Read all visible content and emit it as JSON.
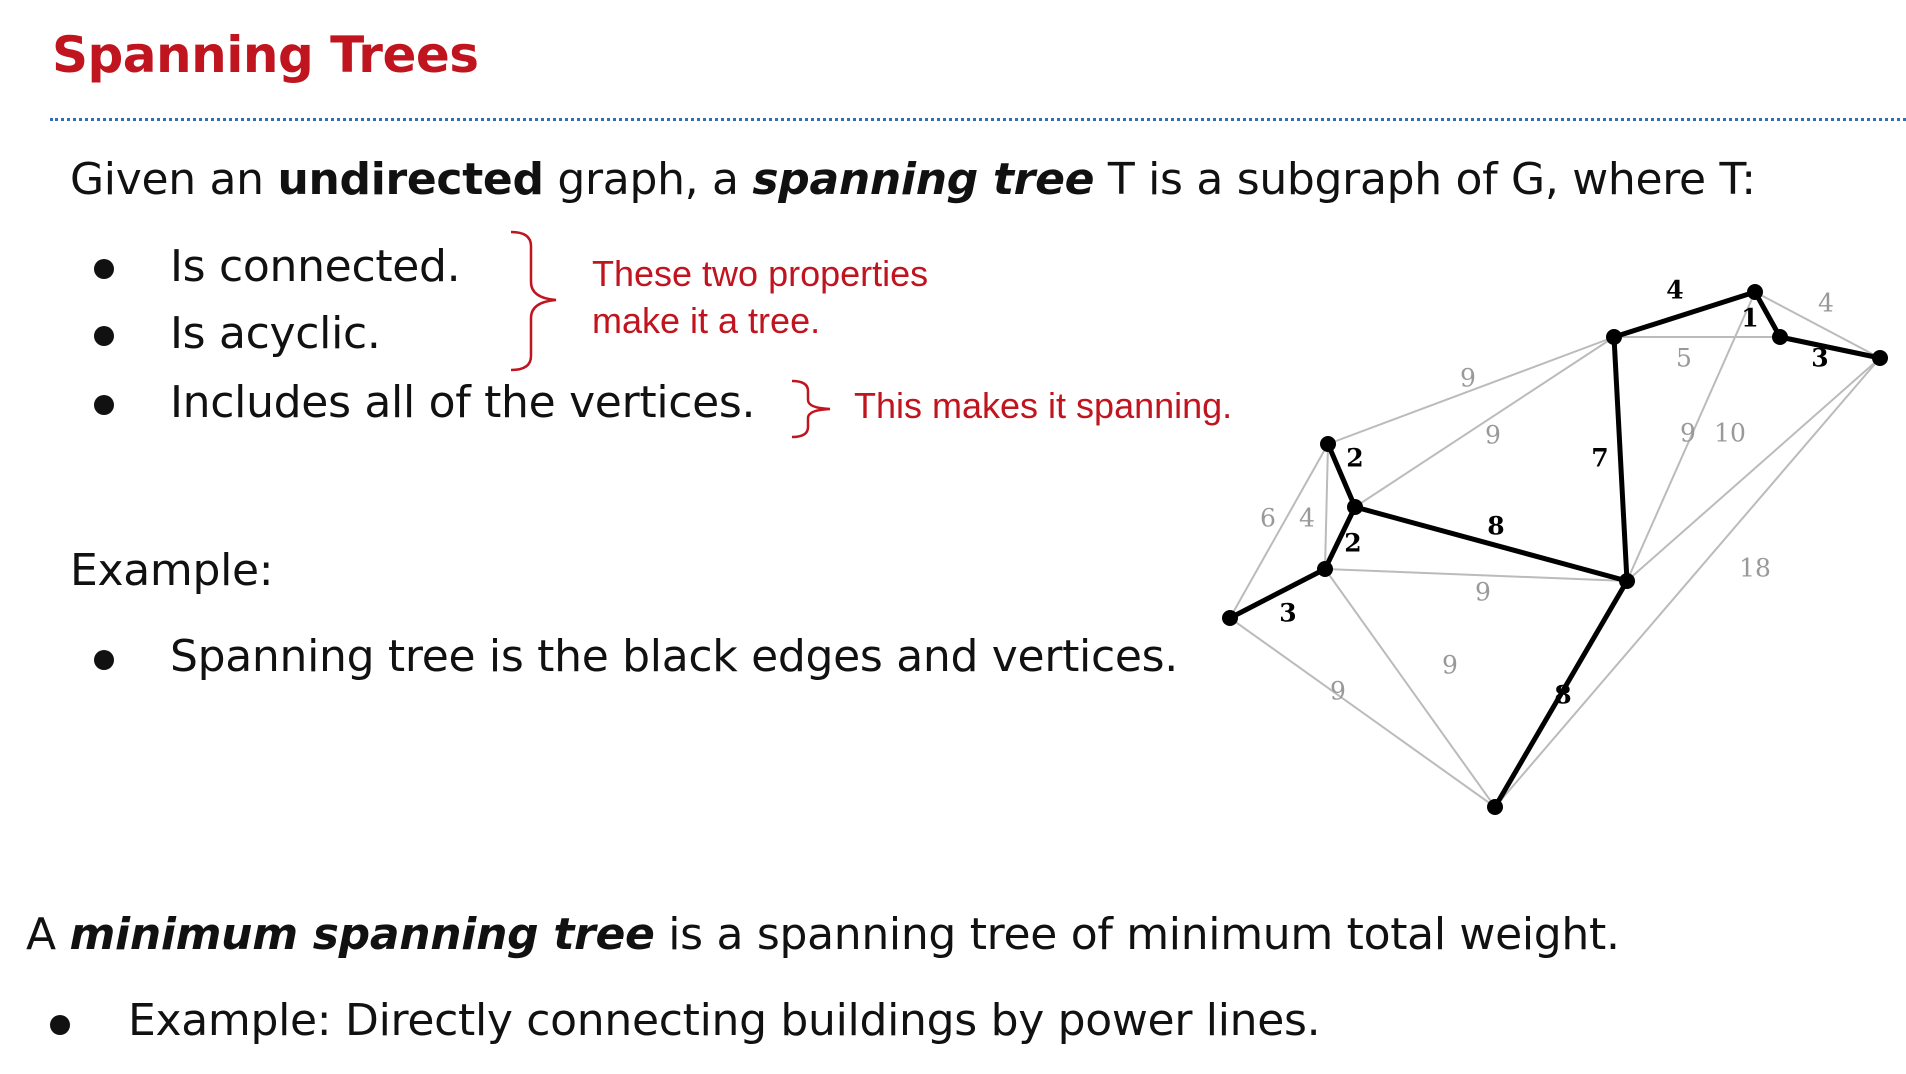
{
  "title": "Spanning Trees",
  "intro": {
    "t1": "Given an ",
    "t2": "undirected",
    "t3": " graph, a ",
    "t4": "spanning tree",
    "t5": " T is a subgraph of G, where T:"
  },
  "properties": [
    "Is connected.",
    "Is acyclic.",
    "Includes all of the vertices."
  ],
  "notes": {
    "tree_line1": "These two properties",
    "tree_line2": "make it a tree.",
    "spanning": "This makes it spanning."
  },
  "example": {
    "heading": "Example:",
    "bullet": "Spanning tree is the black edges and vertices."
  },
  "mst": {
    "t1": "A ",
    "t2": "minimum spanning tree",
    "t3": " is a spanning tree of minimum total weight.",
    "example": "Example: Directly connecting buildings by power lines."
  },
  "colors": {
    "title": "#c0141f",
    "note": "#c0141f",
    "divider": "#2f6fb5",
    "tree_edge": "#000000",
    "other_edge": "#bbbbbb",
    "other_label": "#999999"
  },
  "graph": {
    "vertices": [
      "A",
      "B",
      "C",
      "D",
      "E",
      "F",
      "G",
      "H",
      "I",
      "J"
    ],
    "tree_edges": [
      {
        "from": "A",
        "to": "B",
        "weight": "4"
      },
      {
        "from": "B",
        "to": "C",
        "weight": "1"
      },
      {
        "from": "C",
        "to": "D",
        "weight": "3"
      },
      {
        "from": "A",
        "to": "E",
        "weight": "7"
      },
      {
        "from": "G",
        "to": "E",
        "weight": "8"
      },
      {
        "from": "F",
        "to": "G",
        "weight": "2"
      },
      {
        "from": "G",
        "to": "H",
        "weight": "2"
      },
      {
        "from": "I",
        "to": "H",
        "weight": "3"
      },
      {
        "from": "E",
        "to": "J",
        "weight": "8"
      }
    ],
    "other_edges": [
      {
        "from": "B",
        "to": "D",
        "weight": "4"
      },
      {
        "from": "A",
        "to": "C",
        "weight": "5"
      },
      {
        "from": "F",
        "to": "A",
        "weight": "9"
      },
      {
        "from": "G",
        "to": "A",
        "weight": "9"
      },
      {
        "from": "E",
        "to": "B",
        "weight": "9"
      },
      {
        "from": "E",
        "to": "D",
        "weight": "10"
      },
      {
        "from": "J",
        "to": "D",
        "weight": "18"
      },
      {
        "from": "I",
        "to": "F",
        "weight": "6"
      },
      {
        "from": "F",
        "to": "H",
        "weight": "4"
      },
      {
        "from": "H",
        "to": "E",
        "weight": "9"
      },
      {
        "from": "H",
        "to": "J",
        "weight": "9"
      },
      {
        "from": "I",
        "to": "J",
        "weight": "9"
      }
    ]
  }
}
